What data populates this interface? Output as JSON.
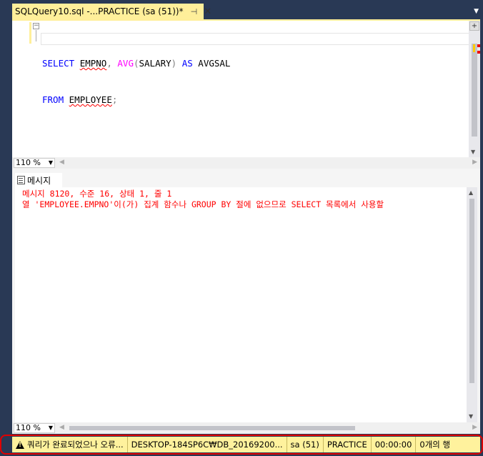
{
  "tab": {
    "title": "SQLQuery10.sql -...PRACTICE (sa (51))*",
    "pin_icon": "pin-icon",
    "close_icon": "close-icon"
  },
  "editor": {
    "line1": {
      "kw1": "SELECT",
      "col1": "EMPNO",
      "comma": ", ",
      "fn": "AVG",
      "paren_open": "(",
      "col2": "SALARY",
      "paren_close": ")",
      "kw2": " AS ",
      "alias": "AVGSAL"
    },
    "line2": {
      "kw": "FROM",
      "table": "EMPLOYEE",
      "semi": ";"
    },
    "zoom": "110 %"
  },
  "results": {
    "tab_label": "메시지",
    "message_line1": "메시지 8120, 수준 16, 상태 1, 줄 1",
    "message_line2": "열 'EMPLOYEE.EMPNO'이(가) 집계 함수나 GROUP BY 절에 없으므로 SELECT 목록에서 사용할",
    "zoom": "110 %"
  },
  "status": {
    "state": "쿼리가 완료되었으나 오류...",
    "server": "DESKTOP-184SP6C₩DB_20169200...",
    "user": "sa (51)",
    "database": "PRACTICE",
    "elapsed": "00:00:00",
    "rows": "0개의 행"
  },
  "colors": {
    "tab_accent": "#ffef9a",
    "keyword": "#0000ff",
    "function": "#ff00ff",
    "error_text": "#ff0000",
    "status_bg": "#fff29d",
    "frame_bg": "#293955"
  }
}
